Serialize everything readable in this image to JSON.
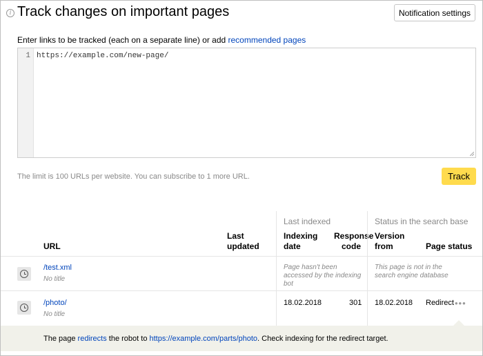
{
  "header": {
    "title": "Track changes on important pages",
    "notification_button": "Notification settings",
    "info_glyph": "i"
  },
  "intro": {
    "text": "Enter links to be tracked (each on a separate line) or add ",
    "link": "recommended pages"
  },
  "editor": {
    "lines": [
      {
        "number": "1",
        "text": "https://example.com/new-page/"
      }
    ]
  },
  "limit_text": "The limit is 100 URLs per website. You can subscribe to 1 more URL.",
  "track_button": "Track",
  "table": {
    "group_labels": {
      "last_indexed": "Last indexed",
      "status_in_search_base": "Status in the search base"
    },
    "headers": {
      "url": "URL",
      "last_updated_1": "Last",
      "last_updated_2": "updated",
      "indexing_date_1": "Indexing",
      "indexing_date_2": "date",
      "response_code_1": "Response",
      "response_code_2": "code",
      "version_from_1": "Version",
      "version_from_2": "from",
      "page_status": "Page status"
    },
    "rows": [
      {
        "icon": "clock-icon",
        "url": "/test.xml",
        "title": "No title",
        "last_updated": "",
        "indexing_note": "Page hasn't been accessed by the indexing bot",
        "status_note": "This page is not in the search engine database"
      },
      {
        "icon": "clock-icon",
        "url": "/photo/",
        "title": "No title",
        "last_updated": "",
        "indexing_date": "18.02.2018",
        "response_code": "301",
        "version_from": "18.02.2018",
        "page_status": "Redirect",
        "more": "•••"
      }
    ]
  },
  "redirect_info": {
    "prefix": "The page ",
    "link1": "redirects",
    "middle": " the robot to ",
    "link2": "https://example.com/parts/photo",
    "suffix": ". Check indexing for the redirect target."
  }
}
